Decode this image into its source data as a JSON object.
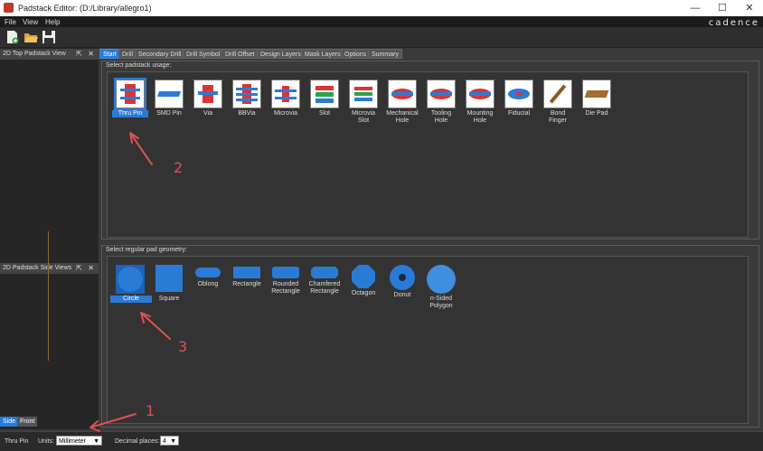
{
  "window": {
    "title": "Padstack Editor:  (D:/Library/allegro1)",
    "minimize": "—",
    "maximize": "☐",
    "close": "✕"
  },
  "menu": {
    "items": [
      "File",
      "View",
      "Help"
    ],
    "brand": "cadence"
  },
  "toolbar": {
    "icons": [
      "new-file-icon",
      "open-folder-icon",
      "save-icon"
    ]
  },
  "left_panel": {
    "top_title": "2D Top Padstack View",
    "side_title": "2D Padstack Side Views",
    "bottom_tabs": [
      "Side",
      "Front"
    ]
  },
  "tabs": [
    "Start",
    "Drill",
    "Secondary Drill",
    "Drill Symbol",
    "Drill Offset",
    "Design Layers",
    "Mask Layers",
    "Options",
    "Summary"
  ],
  "usage": {
    "label": "Select padstack usage:",
    "items": [
      "Thru Pin",
      "SMD Pin",
      "Via",
      "BBVia",
      "Microvia",
      "Slot",
      "Microvia\nSlot",
      "Mechanical\nHole",
      "Tooling\nHole",
      "Mounting\nHole",
      "Fiducial",
      "Bond\nFinger",
      "Die Pad"
    ],
    "selected": "Thru Pin"
  },
  "geometry": {
    "label": "Select regular pad geometry:",
    "items": [
      "Circle",
      "Square",
      "Oblong",
      "Rectangle",
      "Rounded\nRectangle",
      "Chamfered\nRectangle",
      "Octagon",
      "Donut",
      "n-Sided\nPolygon"
    ],
    "selected": "Circle"
  },
  "status": {
    "usage": "Thru Pin",
    "units_label": "Units:",
    "units_value": "Millimeter",
    "decimal_label": "Decimal places:",
    "decimal_value": "4"
  },
  "annotations": [
    "1",
    "2",
    "3"
  ],
  "colors": {
    "accent": "#2a7bd6",
    "annotation": "#e05050"
  }
}
